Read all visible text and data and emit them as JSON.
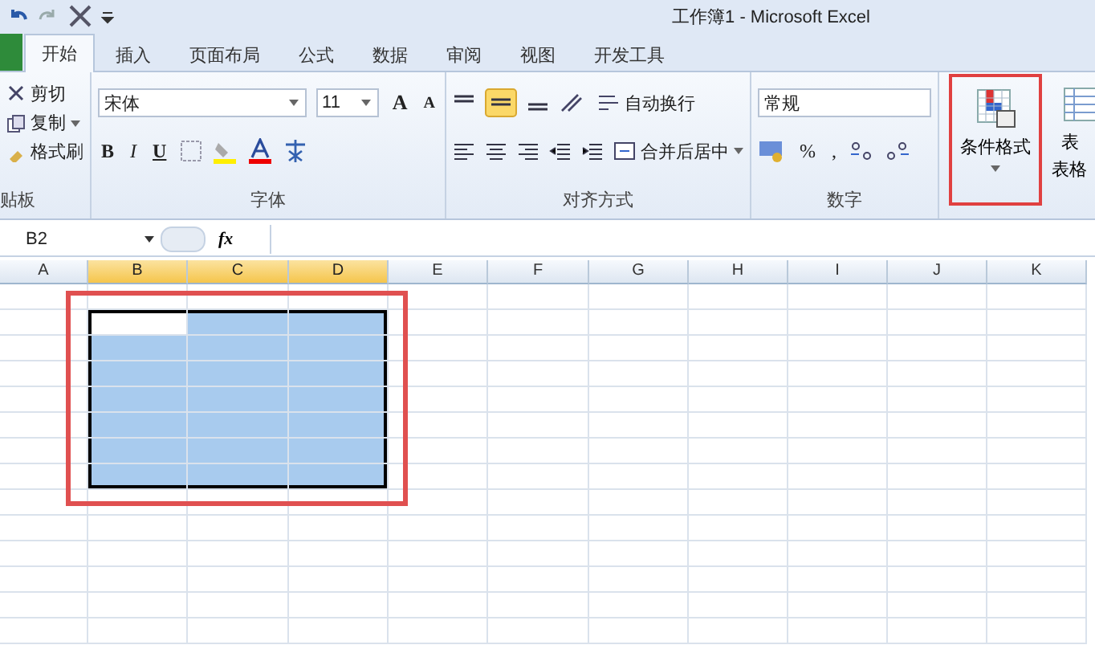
{
  "window": {
    "title": "工作簿1 - Microsoft Excel"
  },
  "tabs": [
    {
      "label": "开始",
      "selected": true
    },
    {
      "label": "插入",
      "selected": false
    },
    {
      "label": "页面布局",
      "selected": false
    },
    {
      "label": "公式",
      "selected": false
    },
    {
      "label": "数据",
      "selected": false
    },
    {
      "label": "审阅",
      "selected": false
    },
    {
      "label": "视图",
      "selected": false
    },
    {
      "label": "开发工具",
      "selected": false
    }
  ],
  "ribbon": {
    "clipboard": {
      "label": "贴板",
      "cut": "剪切",
      "copy": "复制",
      "format_painter": "格式刷"
    },
    "font": {
      "label": "字体",
      "font_name": "宋体",
      "font_size": "11",
      "grow": "A",
      "shrink": "A",
      "bold": "B",
      "italic": "I",
      "underline": "U"
    },
    "alignment": {
      "label": "对齐方式",
      "wrap_text": "自动换行",
      "merge_center": "合并后居中"
    },
    "number": {
      "label": "数字",
      "format": "常规",
      "percent": "%",
      "comma": ","
    },
    "styles": {
      "conditional_formatting": "条件格式",
      "highlighted": true,
      "format_as_table_top": "表",
      "format_as_table_bottom": "表格"
    }
  },
  "formula_bar": {
    "name_box": "B2",
    "fx": "fx"
  },
  "columns": [
    {
      "label": "A",
      "selected": false
    },
    {
      "label": "B",
      "selected": true
    },
    {
      "label": "C",
      "selected": true
    },
    {
      "label": "D",
      "selected": true
    },
    {
      "label": "E",
      "selected": false
    },
    {
      "label": "F",
      "selected": false
    },
    {
      "label": "G",
      "selected": false
    },
    {
      "label": "H",
      "selected": false
    },
    {
      "label": "I",
      "selected": false
    },
    {
      "label": "J",
      "selected": false
    },
    {
      "label": "K",
      "selected": false
    }
  ],
  "rows": [
    {
      "cells": [
        {
          "selected": false,
          "active": false
        },
        {
          "selected": false,
          "active": false
        },
        {
          "selected": false,
          "active": false
        },
        {
          "selected": false,
          "active": false
        },
        {
          "selected": false,
          "active": false
        },
        {
          "selected": false,
          "active": false
        },
        {
          "selected": false,
          "active": false
        },
        {
          "selected": false,
          "active": false
        },
        {
          "selected": false,
          "active": false
        },
        {
          "selected": false,
          "active": false
        },
        {
          "selected": false,
          "active": false
        }
      ]
    },
    {
      "cells": [
        {
          "selected": false,
          "active": false
        },
        {
          "selected": true,
          "active": true
        },
        {
          "selected": true,
          "active": false
        },
        {
          "selected": true,
          "active": false
        },
        {
          "selected": false,
          "active": false
        },
        {
          "selected": false,
          "active": false
        },
        {
          "selected": false,
          "active": false
        },
        {
          "selected": false,
          "active": false
        },
        {
          "selected": false,
          "active": false
        },
        {
          "selected": false,
          "active": false
        },
        {
          "selected": false,
          "active": false
        }
      ]
    },
    {
      "cells": [
        {
          "selected": false,
          "active": false
        },
        {
          "selected": true,
          "active": false
        },
        {
          "selected": true,
          "active": false
        },
        {
          "selected": true,
          "active": false
        },
        {
          "selected": false,
          "active": false
        },
        {
          "selected": false,
          "active": false
        },
        {
          "selected": false,
          "active": false
        },
        {
          "selected": false,
          "active": false
        },
        {
          "selected": false,
          "active": false
        },
        {
          "selected": false,
          "active": false
        },
        {
          "selected": false,
          "active": false
        }
      ]
    },
    {
      "cells": [
        {
          "selected": false,
          "active": false
        },
        {
          "selected": true,
          "active": false
        },
        {
          "selected": true,
          "active": false
        },
        {
          "selected": true,
          "active": false
        },
        {
          "selected": false,
          "active": false
        },
        {
          "selected": false,
          "active": false
        },
        {
          "selected": false,
          "active": false
        },
        {
          "selected": false,
          "active": false
        },
        {
          "selected": false,
          "active": false
        },
        {
          "selected": false,
          "active": false
        },
        {
          "selected": false,
          "active": false
        }
      ]
    },
    {
      "cells": [
        {
          "selected": false,
          "active": false
        },
        {
          "selected": true,
          "active": false
        },
        {
          "selected": true,
          "active": false
        },
        {
          "selected": true,
          "active": false
        },
        {
          "selected": false,
          "active": false
        },
        {
          "selected": false,
          "active": false
        },
        {
          "selected": false,
          "active": false
        },
        {
          "selected": false,
          "active": false
        },
        {
          "selected": false,
          "active": false
        },
        {
          "selected": false,
          "active": false
        },
        {
          "selected": false,
          "active": false
        }
      ]
    },
    {
      "cells": [
        {
          "selected": false,
          "active": false
        },
        {
          "selected": true,
          "active": false
        },
        {
          "selected": true,
          "active": false
        },
        {
          "selected": true,
          "active": false
        },
        {
          "selected": false,
          "active": false
        },
        {
          "selected": false,
          "active": false
        },
        {
          "selected": false,
          "active": false
        },
        {
          "selected": false,
          "active": false
        },
        {
          "selected": false,
          "active": false
        },
        {
          "selected": false,
          "active": false
        },
        {
          "selected": false,
          "active": false
        }
      ]
    },
    {
      "cells": [
        {
          "selected": false,
          "active": false
        },
        {
          "selected": true,
          "active": false
        },
        {
          "selected": true,
          "active": false
        },
        {
          "selected": true,
          "active": false
        },
        {
          "selected": false,
          "active": false
        },
        {
          "selected": false,
          "active": false
        },
        {
          "selected": false,
          "active": false
        },
        {
          "selected": false,
          "active": false
        },
        {
          "selected": false,
          "active": false
        },
        {
          "selected": false,
          "active": false
        },
        {
          "selected": false,
          "active": false
        }
      ]
    },
    {
      "cells": [
        {
          "selected": false,
          "active": false
        },
        {
          "selected": true,
          "active": false
        },
        {
          "selected": true,
          "active": false
        },
        {
          "selected": true,
          "active": false
        },
        {
          "selected": false,
          "active": false
        },
        {
          "selected": false,
          "active": false
        },
        {
          "selected": false,
          "active": false
        },
        {
          "selected": false,
          "active": false
        },
        {
          "selected": false,
          "active": false
        },
        {
          "selected": false,
          "active": false
        },
        {
          "selected": false,
          "active": false
        }
      ]
    },
    {
      "cells": [
        {
          "selected": false,
          "active": false
        },
        {
          "selected": false,
          "active": false
        },
        {
          "selected": false,
          "active": false
        },
        {
          "selected": false,
          "active": false
        },
        {
          "selected": false,
          "active": false
        },
        {
          "selected": false,
          "active": false
        },
        {
          "selected": false,
          "active": false
        },
        {
          "selected": false,
          "active": false
        },
        {
          "selected": false,
          "active": false
        },
        {
          "selected": false,
          "active": false
        },
        {
          "selected": false,
          "active": false
        }
      ]
    },
    {
      "cells": [
        {
          "selected": false,
          "active": false
        },
        {
          "selected": false,
          "active": false
        },
        {
          "selected": false,
          "active": false
        },
        {
          "selected": false,
          "active": false
        },
        {
          "selected": false,
          "active": false
        },
        {
          "selected": false,
          "active": false
        },
        {
          "selected": false,
          "active": false
        },
        {
          "selected": false,
          "active": false
        },
        {
          "selected": false,
          "active": false
        },
        {
          "selected": false,
          "active": false
        },
        {
          "selected": false,
          "active": false
        }
      ]
    },
    {
      "cells": [
        {
          "selected": false,
          "active": false
        },
        {
          "selected": false,
          "active": false
        },
        {
          "selected": false,
          "active": false
        },
        {
          "selected": false,
          "active": false
        },
        {
          "selected": false,
          "active": false
        },
        {
          "selected": false,
          "active": false
        },
        {
          "selected": false,
          "active": false
        },
        {
          "selected": false,
          "active": false
        },
        {
          "selected": false,
          "active": false
        },
        {
          "selected": false,
          "active": false
        },
        {
          "selected": false,
          "active": false
        }
      ]
    },
    {
      "cells": [
        {
          "selected": false,
          "active": false
        },
        {
          "selected": false,
          "active": false
        },
        {
          "selected": false,
          "active": false
        },
        {
          "selected": false,
          "active": false
        },
        {
          "selected": false,
          "active": false
        },
        {
          "selected": false,
          "active": false
        },
        {
          "selected": false,
          "active": false
        },
        {
          "selected": false,
          "active": false
        },
        {
          "selected": false,
          "active": false
        },
        {
          "selected": false,
          "active": false
        },
        {
          "selected": false,
          "active": false
        }
      ]
    },
    {
      "cells": [
        {
          "selected": false,
          "active": false
        },
        {
          "selected": false,
          "active": false
        },
        {
          "selected": false,
          "active": false
        },
        {
          "selected": false,
          "active": false
        },
        {
          "selected": false,
          "active": false
        },
        {
          "selected": false,
          "active": false
        },
        {
          "selected": false,
          "active": false
        },
        {
          "selected": false,
          "active": false
        },
        {
          "selected": false,
          "active": false
        },
        {
          "selected": false,
          "active": false
        },
        {
          "selected": false,
          "active": false
        }
      ]
    },
    {
      "cells": [
        {
          "selected": false,
          "active": false
        },
        {
          "selected": false,
          "active": false
        },
        {
          "selected": false,
          "active": false
        },
        {
          "selected": false,
          "active": false
        },
        {
          "selected": false,
          "active": false
        },
        {
          "selected": false,
          "active": false
        },
        {
          "selected": false,
          "active": false
        },
        {
          "selected": false,
          "active": false
        },
        {
          "selected": false,
          "active": false
        },
        {
          "selected": false,
          "active": false
        },
        {
          "selected": false,
          "active": false
        }
      ]
    }
  ],
  "selection_highlighted": true
}
